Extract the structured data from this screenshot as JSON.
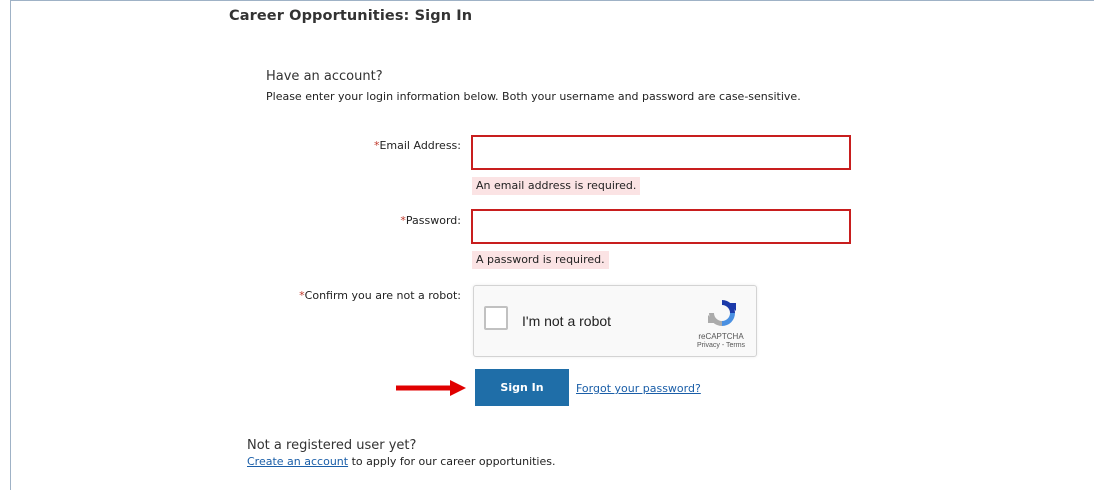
{
  "page": {
    "title": "Career Opportunities: Sign In"
  },
  "login": {
    "heading": "Have an account?",
    "instructions": "Please enter your login information below. Both your username and password are case-sensitive.",
    "required_mark": "*",
    "email_label": "Email Address:",
    "email_value": "",
    "email_error": "An email address is required.",
    "password_label": "Password:",
    "password_value": "",
    "password_error": "A password is required.",
    "robot_label": "Confirm you are not a robot:"
  },
  "recaptcha": {
    "label": "I'm not a robot",
    "brand": "reCAPTCHA",
    "privacy": "Privacy",
    "separator": " - ",
    "terms": "Terms",
    "checked": false
  },
  "actions": {
    "sign_in_label": "Sign In",
    "forgot_password_label": "Forgot your password?"
  },
  "register": {
    "heading": "Not a registered user yet?",
    "create_account_link": "Create an account",
    "create_account_suffix": " to apply for our career opportunities."
  },
  "colors": {
    "error_border": "#c81e1e",
    "error_bg": "#fbe3e4",
    "button_bg": "#1f6ea8",
    "link": "#1a5ea8",
    "annotation_arrow": "#e00000"
  }
}
